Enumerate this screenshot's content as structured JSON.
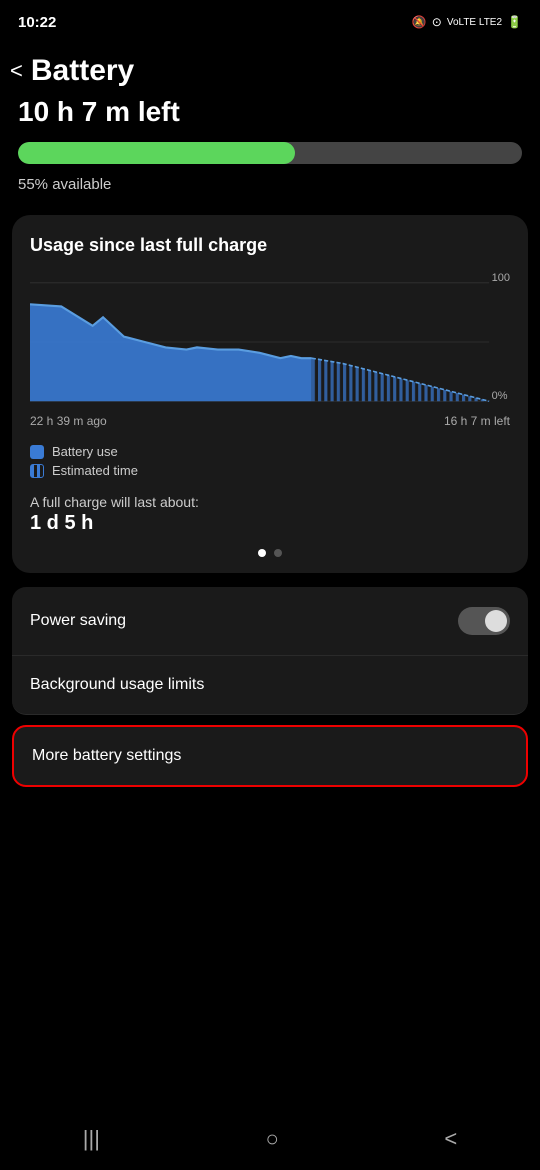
{
  "statusBar": {
    "time": "10:22",
    "icons": "🔕 ⊙ Vo LTE LTE2"
  },
  "header": {
    "backLabel": "<",
    "title": "Battery"
  },
  "batteryInfo": {
    "timeRemaining": "10 h 7 m left",
    "progressPercent": 55,
    "availableText": "55% available"
  },
  "usageCard": {
    "title": "Usage since last full charge",
    "chartLeftLabel": "22 h 39 m ago",
    "chartRightLabel": "16 h 7 m left",
    "chartTopLabel": "100",
    "chartBottomLabel": "0%",
    "legend": [
      {
        "id": "battery-use",
        "label": "Battery use",
        "type": "solid"
      },
      {
        "id": "estimated-time",
        "label": "Estimated time",
        "type": "striped"
      }
    ],
    "fullChargeLabelText": "A full charge will last about:",
    "fullChargeValue": "1 d 5 h"
  },
  "settings": {
    "powerSaving": "Power saving",
    "backgroundUsageLimits": "Background usage limits",
    "moreBatterySettings": "More battery settings"
  },
  "bottomNav": {
    "menu": "|||",
    "home": "○",
    "back": "<"
  }
}
